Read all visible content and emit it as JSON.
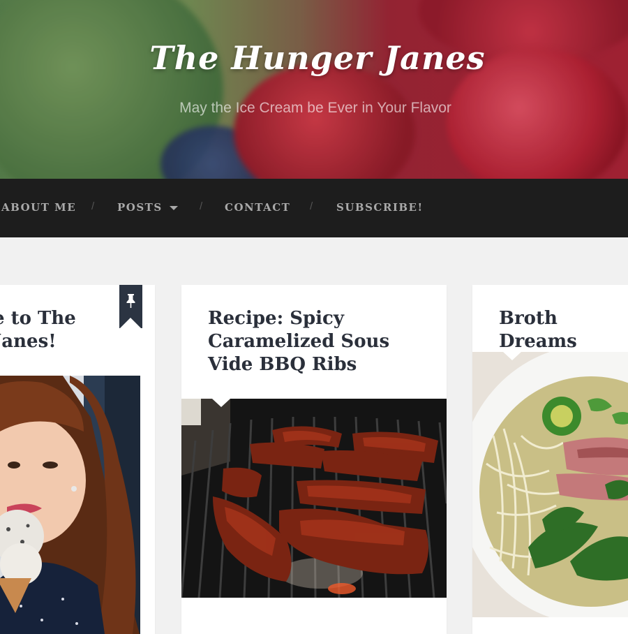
{
  "site": {
    "title": "The Hunger Janes",
    "tagline": "May the Ice Cream be Ever in Your Flavor"
  },
  "nav": {
    "items": [
      "ABOUT ME",
      "POSTS",
      "CONTACT",
      "SUBSCRIBE!"
    ],
    "separator": "/",
    "posts_icon": "caret-down-icon"
  },
  "posts": [
    {
      "title": "e to The\nJanes!",
      "sticky": true,
      "sticky_icon": "pin-icon"
    },
    {
      "title": "Recipe: Spicy\nCaramelized Sous\nVide BBQ Ribs"
    },
    {
      "title": "Broth Dreams"
    }
  ],
  "colors": {
    "nav_bg": "#1d1d1d",
    "nav_text": "#a9a9a9",
    "page_bg": "#f1f1f1",
    "title_text": "#2a2f3a",
    "ribbon": "#2b3442"
  }
}
